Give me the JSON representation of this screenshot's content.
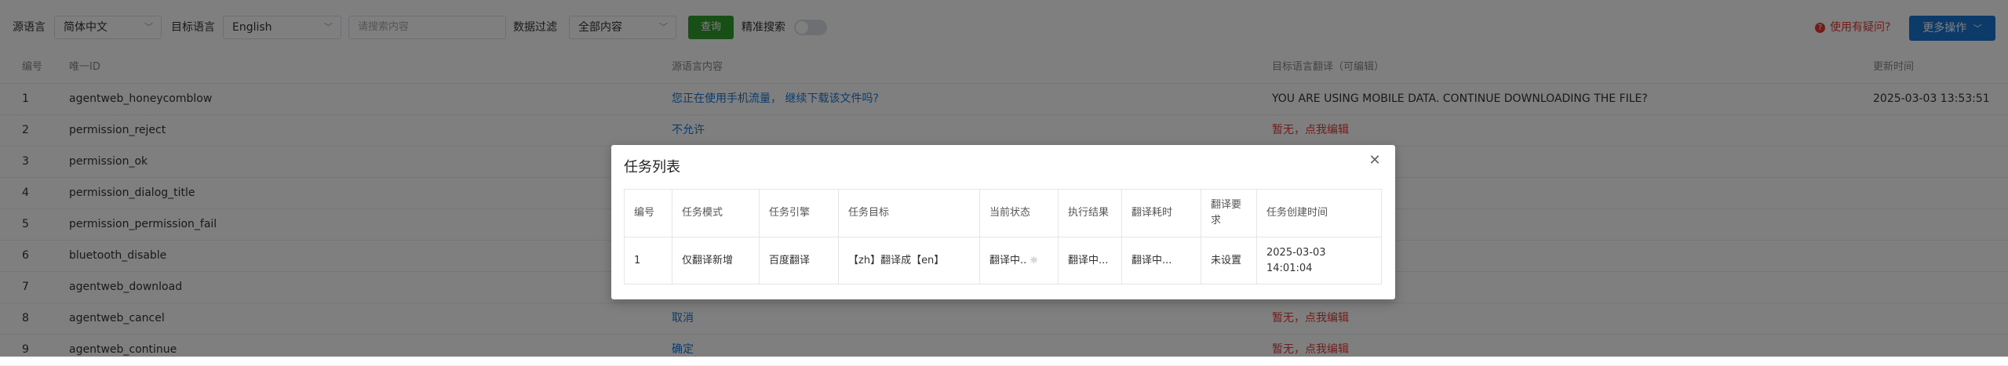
{
  "toolbar": {
    "source_lang_label": "源语言",
    "source_lang_value": "简体中文",
    "target_lang_label": "目标语言",
    "target_lang_value": "English",
    "search_placeholder": "请搜索内容",
    "filter_label": "数据过滤",
    "filter_value": "全部内容",
    "query_button": "查询",
    "exact_search_label": "精准搜索",
    "exact_search_on": false,
    "help_text": "使用有疑问?",
    "more_actions_label": "更多操作"
  },
  "background_table": {
    "headers": [
      "编号",
      "唯一ID",
      "源语言内容",
      "目标语言翻译（可编辑）",
      "更新时间"
    ],
    "rows": [
      {
        "num": "1",
        "key": "agentweb_honeycomblow",
        "source": "您正在使用手机流量， 继续下载该文件吗?",
        "target": "YOU ARE USING MOBILE DATA. CONTINUE DOWNLOADING THE FILE?",
        "time": "2025-03-03 13:53:51"
      },
      {
        "num": "2",
        "key": "permission_reject",
        "source": "不允许",
        "target": "暂无，点我编辑",
        "time": ""
      },
      {
        "num": "3",
        "key": "permission_ok",
        "source": "",
        "target": "",
        "time": ""
      },
      {
        "num": "4",
        "key": "permission_dialog_title",
        "source": "",
        "target": "",
        "time": ""
      },
      {
        "num": "5",
        "key": "permission_permission_fail",
        "source": "",
        "target": "",
        "time": ""
      },
      {
        "num": "6",
        "key": "bluetooth_disable",
        "source": "",
        "target": "",
        "time": ""
      },
      {
        "num": "7",
        "key": "agentweb_download",
        "source": "",
        "target": "",
        "time": ""
      },
      {
        "num": "8",
        "key": "agentweb_cancel",
        "source": "取消",
        "target": "暂无，点我编辑",
        "time": ""
      },
      {
        "num": "9",
        "key": "agentweb_continue",
        "source": "确定",
        "target": "暂无，点我编辑",
        "time": ""
      }
    ]
  },
  "modal": {
    "title": "任务列表",
    "headers": [
      "编号",
      "任务模式",
      "任务引擎",
      "任务目标",
      "当前状态",
      "执行结果",
      "翻译耗时",
      "翻译要求",
      "任务创建时间"
    ],
    "rows": [
      {
        "num": "1",
        "mode": "仅翻译新增",
        "engine": "百度翻译",
        "target": "【zh】翻译成【en】",
        "status": "翻译中..",
        "result": "翻译中...",
        "duration": "翻译中...",
        "requirement": "未设置",
        "created": "2025-03-03 14:01:04"
      }
    ]
  },
  "colors": {
    "query_button": "#2f9e2f",
    "more_actions_button": "#1976d2",
    "help_text": "#e53935",
    "link_blue": "#1976d2"
  }
}
